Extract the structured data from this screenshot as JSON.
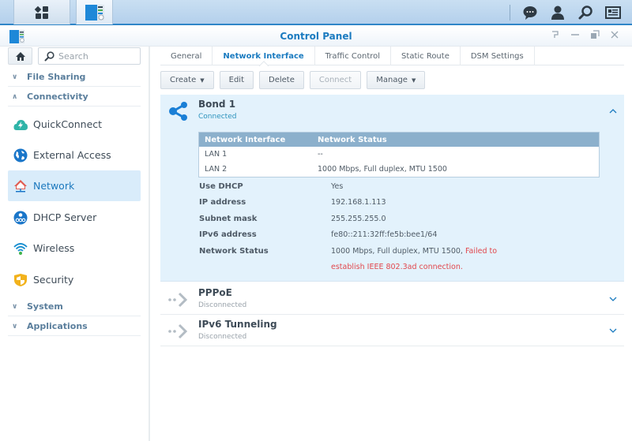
{
  "taskbar": {
    "main_menu_icon": "grid-icon",
    "open_app_icon": "control-panel-icon",
    "right_icons": [
      "chat-icon",
      "user-icon",
      "search-icon",
      "widgets-icon"
    ]
  },
  "window": {
    "title": "Control Panel",
    "controls": [
      "help-icon",
      "minimize-icon",
      "restore-icon",
      "close-icon"
    ]
  },
  "sidebar": {
    "search_placeholder": "Search",
    "categories": [
      {
        "label": "File Sharing",
        "expanded": false
      },
      {
        "label": "Connectivity",
        "expanded": true
      },
      {
        "label": "System",
        "expanded": false
      },
      {
        "label": "Applications",
        "expanded": false
      }
    ],
    "items": [
      {
        "label": "QuickConnect",
        "icon": "quickconnect-icon",
        "active": false
      },
      {
        "label": "External Access",
        "icon": "globe-icon",
        "active": false
      },
      {
        "label": "Network",
        "icon": "network-house-icon",
        "active": true
      },
      {
        "label": "DHCP Server",
        "icon": "dhcp-icon",
        "active": false
      },
      {
        "label": "Wireless",
        "icon": "wifi-icon",
        "active": false
      },
      {
        "label": "Security",
        "icon": "shield-icon",
        "active": false
      }
    ]
  },
  "tabs": [
    {
      "label": "General",
      "active": false
    },
    {
      "label": "Network Interface",
      "active": true
    },
    {
      "label": "Traffic Control",
      "active": false
    },
    {
      "label": "Static Route",
      "active": false
    },
    {
      "label": "DSM Settings",
      "active": false
    }
  ],
  "toolbar": {
    "create": "Create",
    "edit": "Edit",
    "delete": "Delete",
    "connect": "Connect",
    "manage": "Manage"
  },
  "interfaces": [
    {
      "name": "Bond 1",
      "status": "Connected",
      "expanded": true,
      "table": {
        "headers": [
          "Network Interface",
          "Network Status"
        ],
        "rows": [
          [
            "LAN 1",
            "--"
          ],
          [
            "LAN 2",
            "1000 Mbps, Full duplex, MTU 1500"
          ]
        ]
      },
      "details": [
        {
          "label": "Use DHCP",
          "value": "Yes"
        },
        {
          "label": "IP address",
          "value": "192.168.1.113"
        },
        {
          "label": "Subnet mask",
          "value": "255.255.255.0"
        },
        {
          "label": "IPv6 address",
          "value": "fe80::211:32ff:fe5b:bee1/64"
        },
        {
          "label": "Network Status",
          "value": "1000 Mbps, Full duplex, MTU 1500, ",
          "error_line1": "Failed to",
          "error_line2": "establish IEEE 802.3ad connection."
        }
      ]
    },
    {
      "name": "PPPoE",
      "status": "Disconnected",
      "expanded": false
    },
    {
      "name": "IPv6 Tunneling",
      "status": "Disconnected",
      "expanded": false
    }
  ],
  "colors": {
    "accent": "#1b7bc0",
    "connected": "#2d93bd",
    "error": "#e2474c",
    "expanded_bg": "#e3f2fc"
  }
}
